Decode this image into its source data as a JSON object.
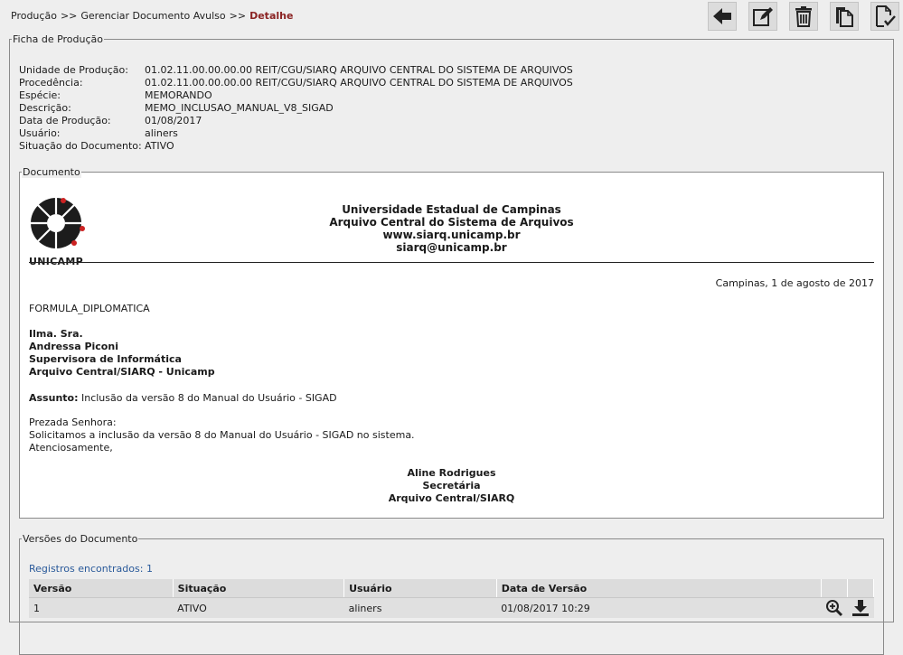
{
  "breadcrumb": {
    "items": [
      "Produção",
      "Gerenciar Documento Avulso"
    ],
    "separator": ">>",
    "current": "Detalhe"
  },
  "toolbar": {
    "buttons": [
      {
        "icon": "arrow-left-icon"
      },
      {
        "icon": "edit-icon"
      },
      {
        "icon": "trash-icon"
      },
      {
        "icon": "copy-icon"
      },
      {
        "icon": "document-check-icon"
      }
    ]
  },
  "ficha": {
    "legend": "Ficha de Produção",
    "rows": [
      {
        "label": "Unidade de Produção:",
        "value": "01.02.11.00.00.00.00 REIT/CGU/SIARQ ARQUIVO CENTRAL DO SISTEMA DE ARQUIVOS"
      },
      {
        "label": "Procedência:",
        "value": "01.02.11.00.00.00.00 REIT/CGU/SIARQ ARQUIVO CENTRAL DO SISTEMA DE ARQUIVOS"
      },
      {
        "label": "Espécie:",
        "value": "MEMORANDO"
      },
      {
        "label": "Descrição:",
        "value": "MEMO_INCLUSAO_MANUAL_V8_SIGAD"
      },
      {
        "label": "Data de Produção:",
        "value": "01/08/2017"
      },
      {
        "label": "Usuário:",
        "value": "aliners"
      },
      {
        "label": "Situação do Documento:",
        "value": "ATIVO"
      }
    ]
  },
  "document": {
    "legend": "Documento",
    "logo_text": "UNICAMP",
    "letterhead": [
      "Universidade Estadual de Campinas",
      "Arquivo Central do Sistema de Arquivos",
      "www.siarq.unicamp.br",
      "siarq@unicamp.br"
    ],
    "date_line": "Campinas, 1 de agosto de 2017",
    "formula": "FORMULA_DIPLOMATICA",
    "recipient": [
      "Ilma. Sra.",
      "Andressa Piconi",
      "Supervisora de Informática",
      "Arquivo Central/SIARQ - Unicamp"
    ],
    "subject_label": "Assunto:",
    "subject_text": " Inclusão da versão 8 do Manual do Usuário - SIGAD",
    "body": [
      "Prezada Senhora:",
      "Solicitamos a inclusão da versão 8 do Manual do Usuário - SIGAD no sistema.",
      "Atenciosamente,"
    ],
    "signature": [
      "Aline Rodrigues",
      "Secretária",
      "Arquivo Central/SIARQ"
    ]
  },
  "versions": {
    "legend": "Versões do Documento",
    "count_text": "Registros encontrados: 1",
    "columns": [
      "Versão",
      "Situação",
      "Usuário",
      "Data de Versão"
    ],
    "rows": [
      {
        "versao": "1",
        "situacao": "ATIVO",
        "usuario": "aliners",
        "data": "01/08/2017 10:29"
      }
    ],
    "row_actions": [
      "zoom-in-icon",
      "download-icon"
    ]
  }
}
